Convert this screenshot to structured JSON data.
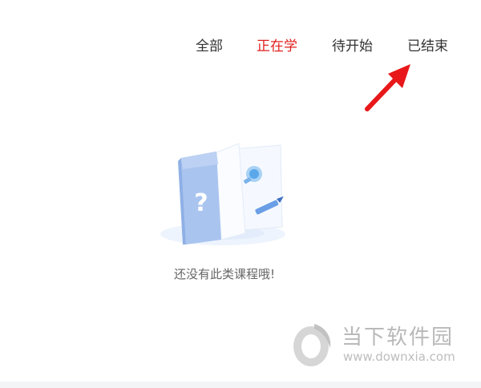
{
  "tabs": [
    {
      "label": "全部",
      "active": false
    },
    {
      "label": "正在学",
      "active": true
    },
    {
      "label": "待开始",
      "active": false
    },
    {
      "label": "已结束",
      "active": false
    }
  ],
  "empty_state": {
    "message": "还没有此类课程哦!",
    "icon": "empty-book-icon"
  },
  "annotation": {
    "icon": "red-arrow-icon",
    "color": "#e8181a"
  },
  "watermark": {
    "title": "当下软件园",
    "url": "www.downxia.com"
  },
  "colors": {
    "active_tab": "#e0201f",
    "tab_text": "#333333",
    "empty_text": "#666666"
  }
}
